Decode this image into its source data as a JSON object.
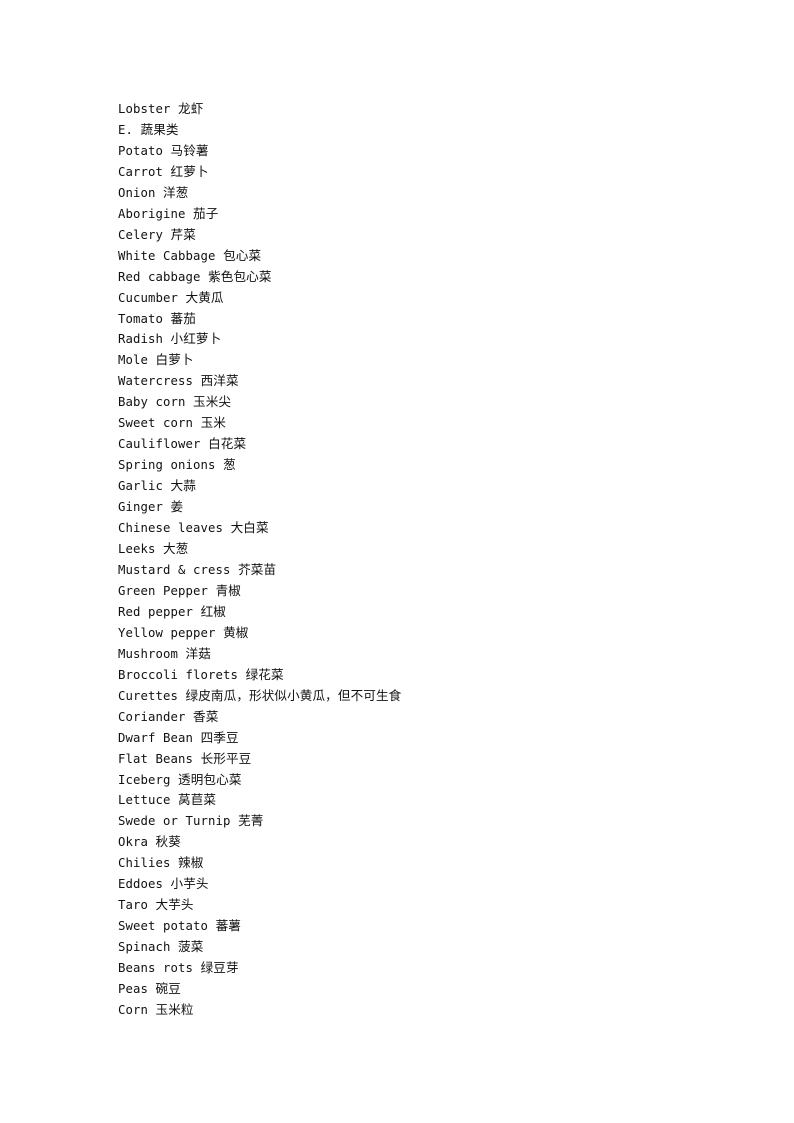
{
  "document": {
    "page_background": "#ffffff",
    "text_color": "#111111",
    "entries": [
      {
        "term": "Lobster",
        "gloss": "龙虾",
        "type": "entry"
      },
      {
        "term": "E.",
        "gloss": "蔬果类",
        "type": "section-heading"
      },
      {
        "term": "Potato",
        "gloss": "马铃薯",
        "type": "entry"
      },
      {
        "term": "Carrot",
        "gloss": "红萝卜",
        "type": "entry"
      },
      {
        "term": "Onion",
        "gloss": "洋葱",
        "type": "entry"
      },
      {
        "term": "Aborigine",
        "gloss": "茄子",
        "type": "entry"
      },
      {
        "term": "Celery",
        "gloss": "芹菜",
        "type": "entry"
      },
      {
        "term": "White Cabbage",
        "gloss": "包心菜",
        "type": "entry"
      },
      {
        "term": "Red cabbage",
        "gloss": "紫色包心菜",
        "type": "entry"
      },
      {
        "term": "Cucumber",
        "gloss": "大黄瓜",
        "type": "entry"
      },
      {
        "term": "Tomato",
        "gloss": "蕃茄",
        "type": "entry"
      },
      {
        "term": "Radish",
        "gloss": "小红萝卜",
        "type": "entry"
      },
      {
        "term": "Mole",
        "gloss": "白萝卜",
        "type": "entry"
      },
      {
        "term": "Watercress",
        "gloss": "西洋菜",
        "type": "entry"
      },
      {
        "term": "Baby corn",
        "gloss": "玉米尖",
        "type": "entry"
      },
      {
        "term": "Sweet corn",
        "gloss": "玉米",
        "type": "entry"
      },
      {
        "term": "Cauliflower",
        "gloss": "白花菜",
        "type": "entry"
      },
      {
        "term": "Spring onions",
        "gloss": "葱",
        "type": "entry"
      },
      {
        "term": "Garlic",
        "gloss": "大蒜",
        "type": "entry"
      },
      {
        "term": "Ginger",
        "gloss": "姜",
        "type": "entry"
      },
      {
        "term": "Chinese leaves",
        "gloss": "大白菜",
        "type": "entry"
      },
      {
        "term": "Leeks",
        "gloss": "大葱",
        "type": "entry"
      },
      {
        "term": "Mustard & cress",
        "gloss": "芥菜苗",
        "type": "entry"
      },
      {
        "term": "Green Pepper",
        "gloss": "青椒",
        "type": "entry"
      },
      {
        "term": "Red pepper",
        "gloss": "红椒",
        "type": "entry"
      },
      {
        "term": "Yellow pepper",
        "gloss": "黄椒",
        "type": "entry"
      },
      {
        "term": "Mushroom",
        "gloss": "洋菇",
        "type": "entry"
      },
      {
        "term": "Broccoli florets",
        "gloss": "绿花菜",
        "type": "entry"
      },
      {
        "term": "Curettes",
        "gloss": "绿皮南瓜，形状似小黄瓜，但不可生食",
        "type": "entry"
      },
      {
        "term": "Coriander",
        "gloss": "香菜",
        "type": "entry"
      },
      {
        "term": "Dwarf Bean",
        "gloss": "四季豆",
        "type": "entry"
      },
      {
        "term": "Flat Beans",
        "gloss": "长形平豆",
        "type": "entry"
      },
      {
        "term": "Iceberg",
        "gloss": "透明包心菜",
        "type": "entry"
      },
      {
        "term": "Lettuce",
        "gloss": "莴苣菜",
        "type": "entry"
      },
      {
        "term": "Swede or Turnip",
        "gloss": "芜菁",
        "type": "entry"
      },
      {
        "term": "Okra",
        "gloss": "秋葵",
        "type": "entry"
      },
      {
        "term": "Chilies",
        "gloss": "辣椒",
        "type": "entry"
      },
      {
        "term": "Eddoes",
        "gloss": "小芋头",
        "type": "entry"
      },
      {
        "term": "Taro",
        "gloss": "大芋头",
        "type": "entry"
      },
      {
        "term": "Sweet potato",
        "gloss": "蕃薯",
        "type": "entry"
      },
      {
        "term": "Spinach",
        "gloss": "菠菜",
        "type": "entry"
      },
      {
        "term": "Beans rots",
        "gloss": "绿豆芽",
        "type": "entry"
      },
      {
        "term": "Peas",
        "gloss": "碗豆",
        "type": "entry"
      },
      {
        "term": "Corn",
        "gloss": "玉米粒",
        "type": "entry"
      }
    ]
  }
}
